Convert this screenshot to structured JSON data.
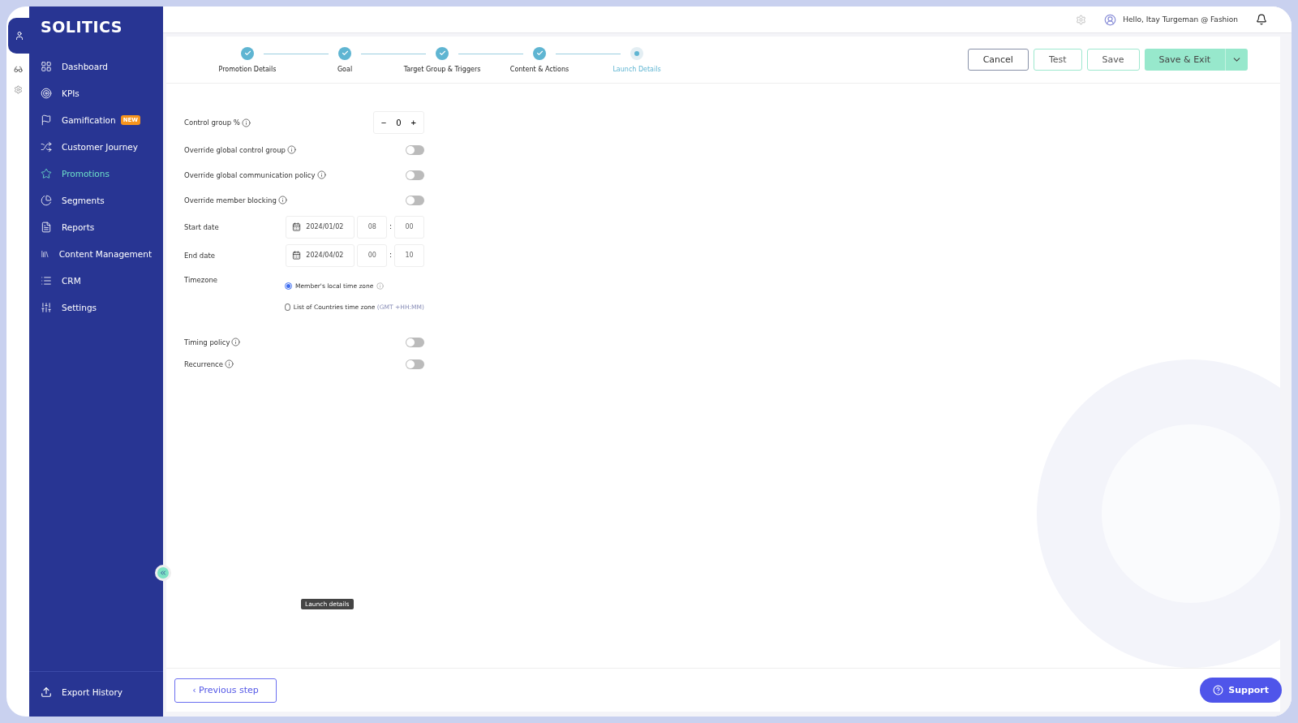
{
  "sidebar": {
    "logo": "SOLITICS",
    "items": [
      {
        "label": "Dashboard",
        "selected": false
      },
      {
        "label": "KPIs",
        "selected": false
      },
      {
        "label": "Gamification",
        "selected": false,
        "badge": "NEW"
      },
      {
        "label": "Customer Journey",
        "selected": false
      },
      {
        "label": "Promotions",
        "selected": true
      },
      {
        "label": "Segments",
        "selected": false
      },
      {
        "label": "Reports",
        "selected": false
      },
      {
        "label": "Content Management",
        "selected": false
      },
      {
        "label": "CRM",
        "selected": false
      },
      {
        "label": "Settings",
        "selected": false
      }
    ],
    "footer_item": {
      "label": "Export History"
    }
  },
  "header": {
    "greeting": "Hello, Itay Turgeman @ Fashion"
  },
  "stepper": [
    {
      "label": "Promotion Details",
      "completed": true,
      "selected": false
    },
    {
      "label": "Goal",
      "completed": true,
      "selected": false
    },
    {
      "label": "Target Group & Triggers",
      "completed": true,
      "selected": false
    },
    {
      "label": "Content & Actions",
      "completed": true,
      "selected": false
    },
    {
      "label": "Launch Details",
      "completed": false,
      "selected": true
    }
  ],
  "actions": [
    {
      "label": "Cancel",
      "kind": "outline"
    },
    {
      "label": "Test",
      "kind": "ghost"
    },
    {
      "label": "Save",
      "kind": "ghost"
    },
    {
      "label": "Save & Exit",
      "kind": "primary"
    }
  ],
  "form": [
    {
      "kind": "counter",
      "label": "Control group %",
      "info": true,
      "value": "0",
      "minus": "−",
      "plus": "+"
    },
    {
      "kind": "toggle",
      "label": "Override global control group",
      "info": true,
      "on": false
    },
    {
      "kind": "toggle",
      "label": "Override global communication policy",
      "info": true,
      "on": false
    },
    {
      "kind": "toggle",
      "label": "Override member blocking",
      "info": true,
      "on": false
    },
    {
      "kind": "datetime",
      "label": "Start date",
      "date": "2024/01/02",
      "hour": "08",
      "minute": "00",
      "separator": ":"
    },
    {
      "kind": "datetime",
      "label": "End date",
      "date": "2024/04/02",
      "hour": "00",
      "minute": "10",
      "separator": ":"
    },
    {
      "kind": "radio",
      "label": "Timezone",
      "options": [
        {
          "label": "Member's local time zone",
          "info": true,
          "selected": true
        },
        {
          "label": "List of Countries time zone",
          "hint": "(GMT +HH:MM)",
          "selected": false
        }
      ]
    },
    {
      "kind": "toggle",
      "label": "Timing policy",
      "info": true,
      "on": false
    },
    {
      "kind": "toggle",
      "label": "Recurrence",
      "info": true,
      "on": false
    }
  ],
  "tooltip": "Launch details",
  "previous_button": {
    "label": "Previous step",
    "arrow": "‹"
  },
  "support_button": {
    "label": "Support"
  }
}
